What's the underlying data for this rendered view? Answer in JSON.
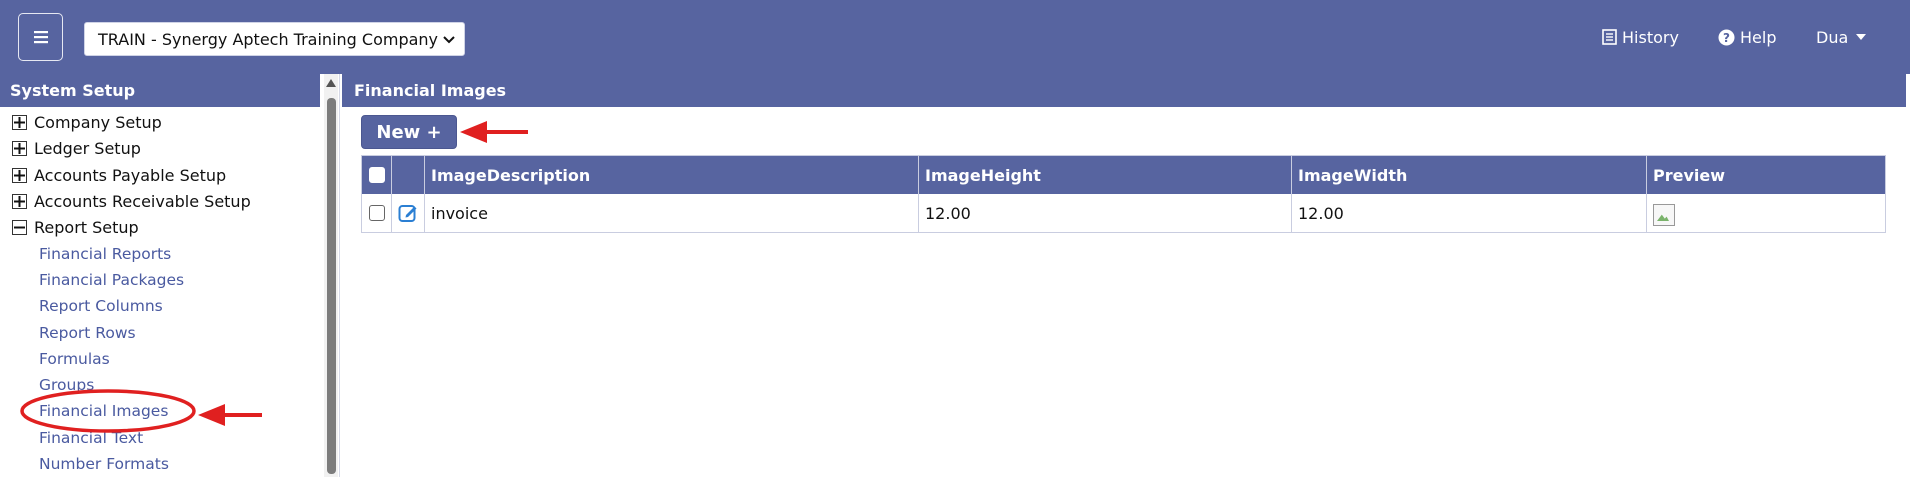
{
  "header": {
    "company_selected": "TRAIN - Synergy Aptech Training Company",
    "history_label": "History",
    "help_label": "Help",
    "user_label": "Dua"
  },
  "sidebar": {
    "title": "System Setup",
    "nodes": [
      {
        "label": "Company Setup",
        "expanded": false
      },
      {
        "label": "Ledger Setup",
        "expanded": false
      },
      {
        "label": "Accounts Payable Setup",
        "expanded": false
      },
      {
        "label": "Accounts Receivable Setup",
        "expanded": false
      },
      {
        "label": "Report Setup",
        "expanded": true
      }
    ],
    "report_items": [
      "Financial Reports",
      "Financial Packages",
      "Report Columns",
      "Report Rows",
      "Formulas",
      "Groups",
      "Financial Images",
      "Financial Text",
      "Number Formats"
    ],
    "highlighted_item": "Financial Images"
  },
  "main": {
    "title": "Financial Images",
    "new_button_label": "New +",
    "columns": [
      "ImageDescription",
      "ImageHeight",
      "ImageWidth",
      "Preview"
    ],
    "rows": [
      {
        "description": "invoice",
        "height": "12.00",
        "width": "12.00"
      }
    ]
  },
  "colors": {
    "brand": "#5764a0",
    "link": "#4a5aa0",
    "annotation": "#e02020"
  }
}
